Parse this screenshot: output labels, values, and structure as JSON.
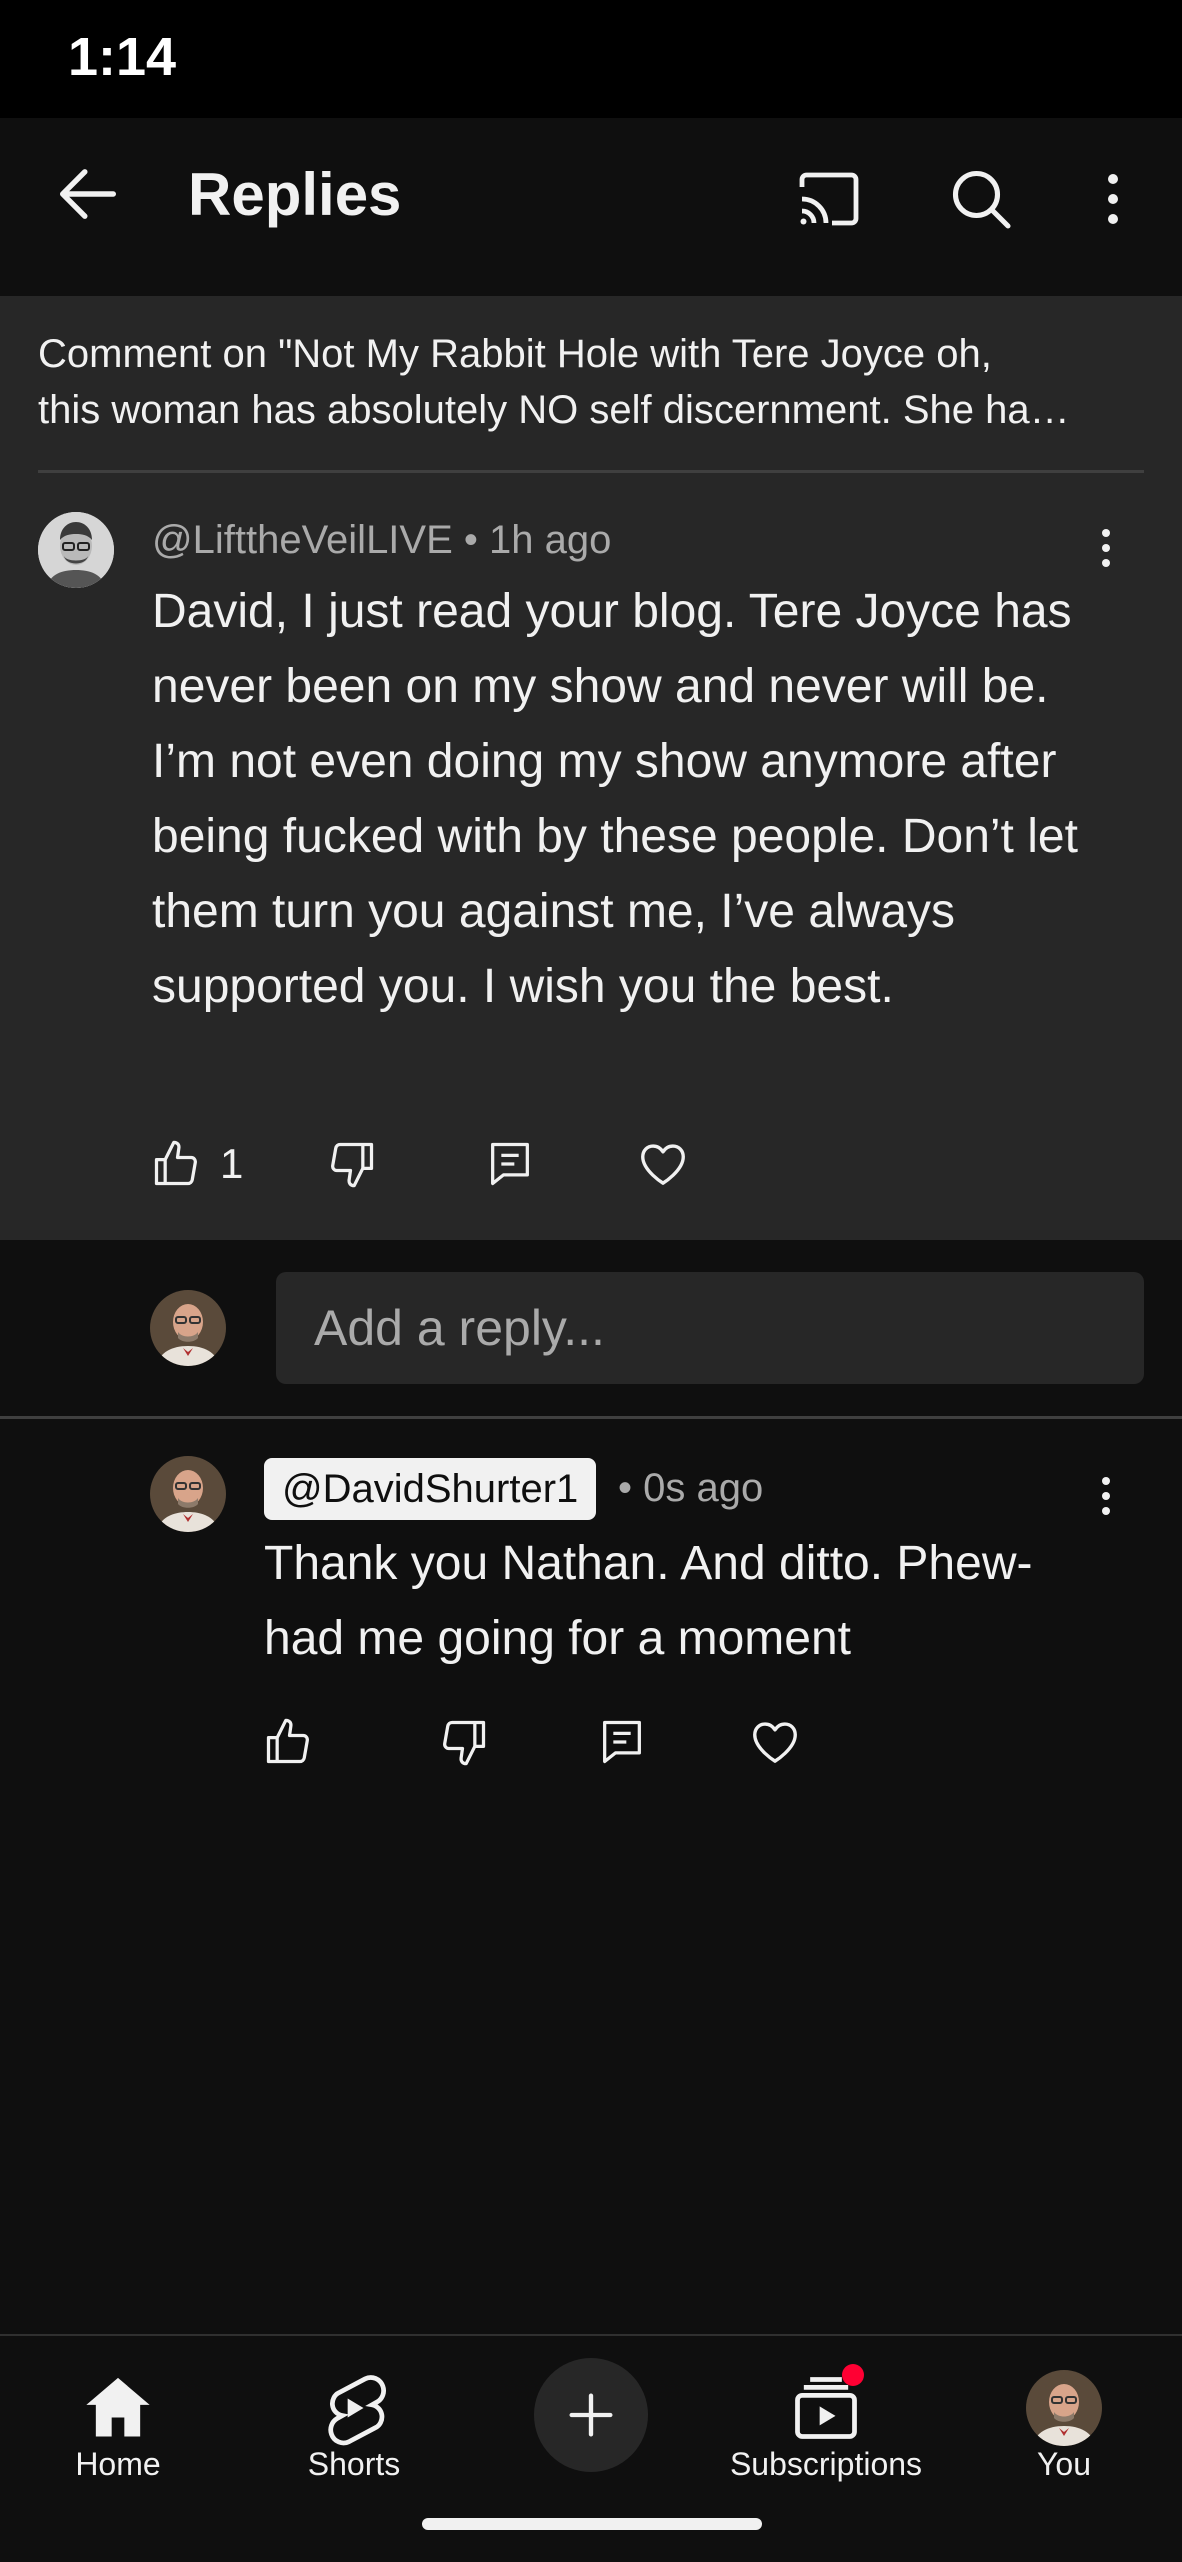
{
  "status": {
    "time": "1:14"
  },
  "header": {
    "title": "Replies",
    "icons": [
      "arrow-back-icon",
      "cast-icon",
      "search-icon",
      "more-vert-icon"
    ]
  },
  "context": {
    "line1": "Comment on \"Not My Rabbit Hole with Tere Joyce  oh,",
    "line2": "this woman has absolutely NO self discernment. She ha…"
  },
  "parent_comment": {
    "meta": "@LifttheVeilLIVE • 1h ago",
    "text": "David, I just read your blog. Tere Joyce has never been on my show and never will be. I’m not even doing my show anymore after being fucked with by these people. Don’t let them turn you against me, I’ve always supported you. I wish you the best.",
    "like_count": "1"
  },
  "reply_input": {
    "placeholder": "Add a reply..."
  },
  "reply": {
    "handle": "@DavidShurter1",
    "time": "• 0s ago",
    "text": "Thank you Nathan. And ditto. Phew- had me going for a moment"
  },
  "nav": {
    "home": "Home",
    "shorts": "Shorts",
    "subscriptions": "Subscriptions",
    "you": "You"
  },
  "colors": {
    "background": "#0f0f0f",
    "surface": "#272727",
    "text": "#f1f1f1",
    "secondary_text": "#aaaaaa",
    "notification_dot": "#ff0033"
  }
}
